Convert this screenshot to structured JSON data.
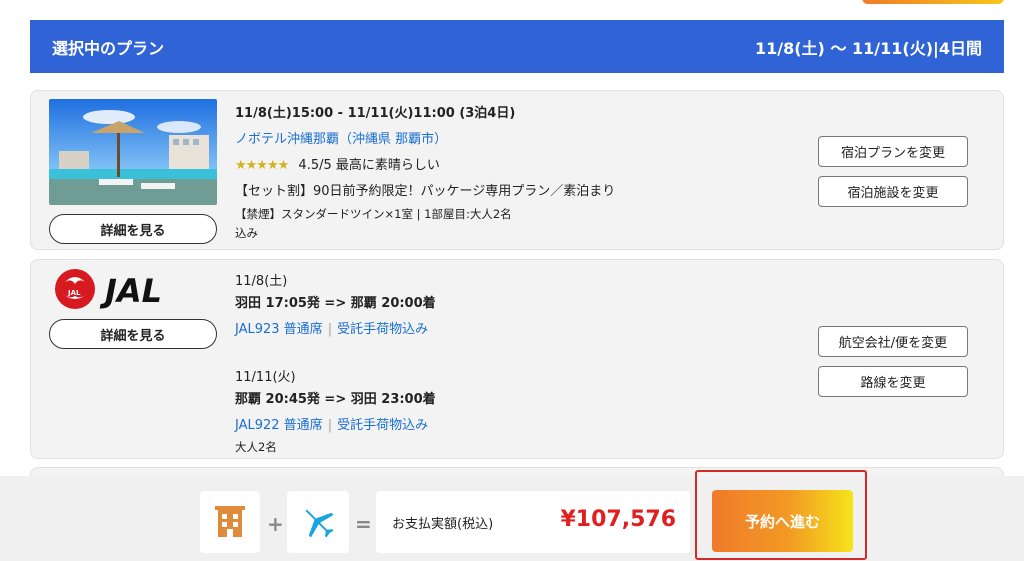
{
  "header": {
    "title": "選択中のプラン",
    "dates": "11/8(土) 〜 11/11(火)|4日間"
  },
  "hotel": {
    "stay": "11/8(土)15:00 - 11/11(火)11:00 (3泊4日)",
    "name": "ノボテル沖縄那覇（沖縄県 那覇市）",
    "stars": "★★★★★",
    "rating_value": 4.5,
    "rating_text": "4.5/5 最高に素晴らしい",
    "plan": "【セット割】90日前予約限定！パッケージ専用プラン／素泊まり",
    "room": "【禁煙】スタンダードツイン×1室 | 1部屋目:大人2名",
    "tax": "込み",
    "detail_label": "詳細を見る",
    "change_plan": "宿泊プランを変更",
    "change_facility": "宿泊施設を変更"
  },
  "flight": {
    "airline": "JAL",
    "detail_label": "詳細を見る",
    "outbound_date": "11/8(土)",
    "outbound_route": "羽田 17:05発 => 那覇 20:00着",
    "outbound_flight": "JAL923 普通席",
    "outbound_baggage": "受託手荷物込み",
    "return_date": "11/11(火)",
    "return_route": "那覇 20:45発 => 羽田 23:00着",
    "return_flight": "JAL922 普通席",
    "return_baggage": "受託手荷物込み",
    "pax": "大人2名",
    "change_airline": "航空会社/便を変更",
    "change_route": "路線を変更"
  },
  "footer": {
    "plus": "+",
    "equals": "=",
    "total_label": "お支払実額(税込)",
    "total_price": "¥107,576",
    "reserve_label": "予約へ進む"
  },
  "colors": {
    "header_bg": "#2f63d6",
    "link": "#1a6fd1",
    "price": "#e02020",
    "cta_start": "#f07a2a",
    "cta_end": "#f6e41a",
    "highlight": "#d32b2b"
  },
  "icons": {
    "hotel": "building-icon",
    "flight": "airplane-icon"
  }
}
